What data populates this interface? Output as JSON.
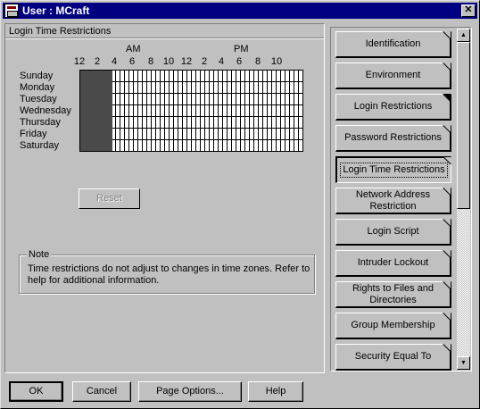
{
  "window": {
    "title": "User : MCraft",
    "close_glyph": "✕"
  },
  "left_panel": {
    "title": "Login Time Restrictions",
    "am_label": "AM",
    "pm_label": "PM",
    "hour_labels": [
      "12",
      "2",
      "4",
      "6",
      "8",
      "10",
      "12",
      "2",
      "4",
      "6",
      "8",
      "10"
    ],
    "days": [
      "Sunday",
      "Monday",
      "Tuesday",
      "Wednesday",
      "Thursday",
      "Friday",
      "Saturday"
    ],
    "grid_colors": {
      "restricted": "#4a4a4a",
      "allowed": "#ffffff"
    },
    "reset_label": "Reset",
    "note": {
      "legend": "Note",
      "text": "Time restrictions do not adjust to changes in time zones.  Refer to help for additional information."
    }
  },
  "page_buttons": [
    {
      "label": "Identification"
    },
    {
      "label": "Environment"
    },
    {
      "label": "Login Restrictions"
    },
    {
      "label": "Password Restrictions"
    },
    {
      "label": "Login Time Restrictions"
    },
    {
      "label": "Network Address Restriction"
    },
    {
      "label": "Login Script"
    },
    {
      "label": "Intruder Lockout"
    },
    {
      "label": "Rights to Files and Directories"
    },
    {
      "label": "Group Membership"
    },
    {
      "label": "Security Equal To"
    }
  ],
  "scrollbar": {
    "up_glyph": "▲",
    "down_glyph": "▼"
  },
  "bottom_buttons": {
    "ok": "OK",
    "cancel": "Cancel",
    "page_options": "Page Options...",
    "help": "Help"
  }
}
